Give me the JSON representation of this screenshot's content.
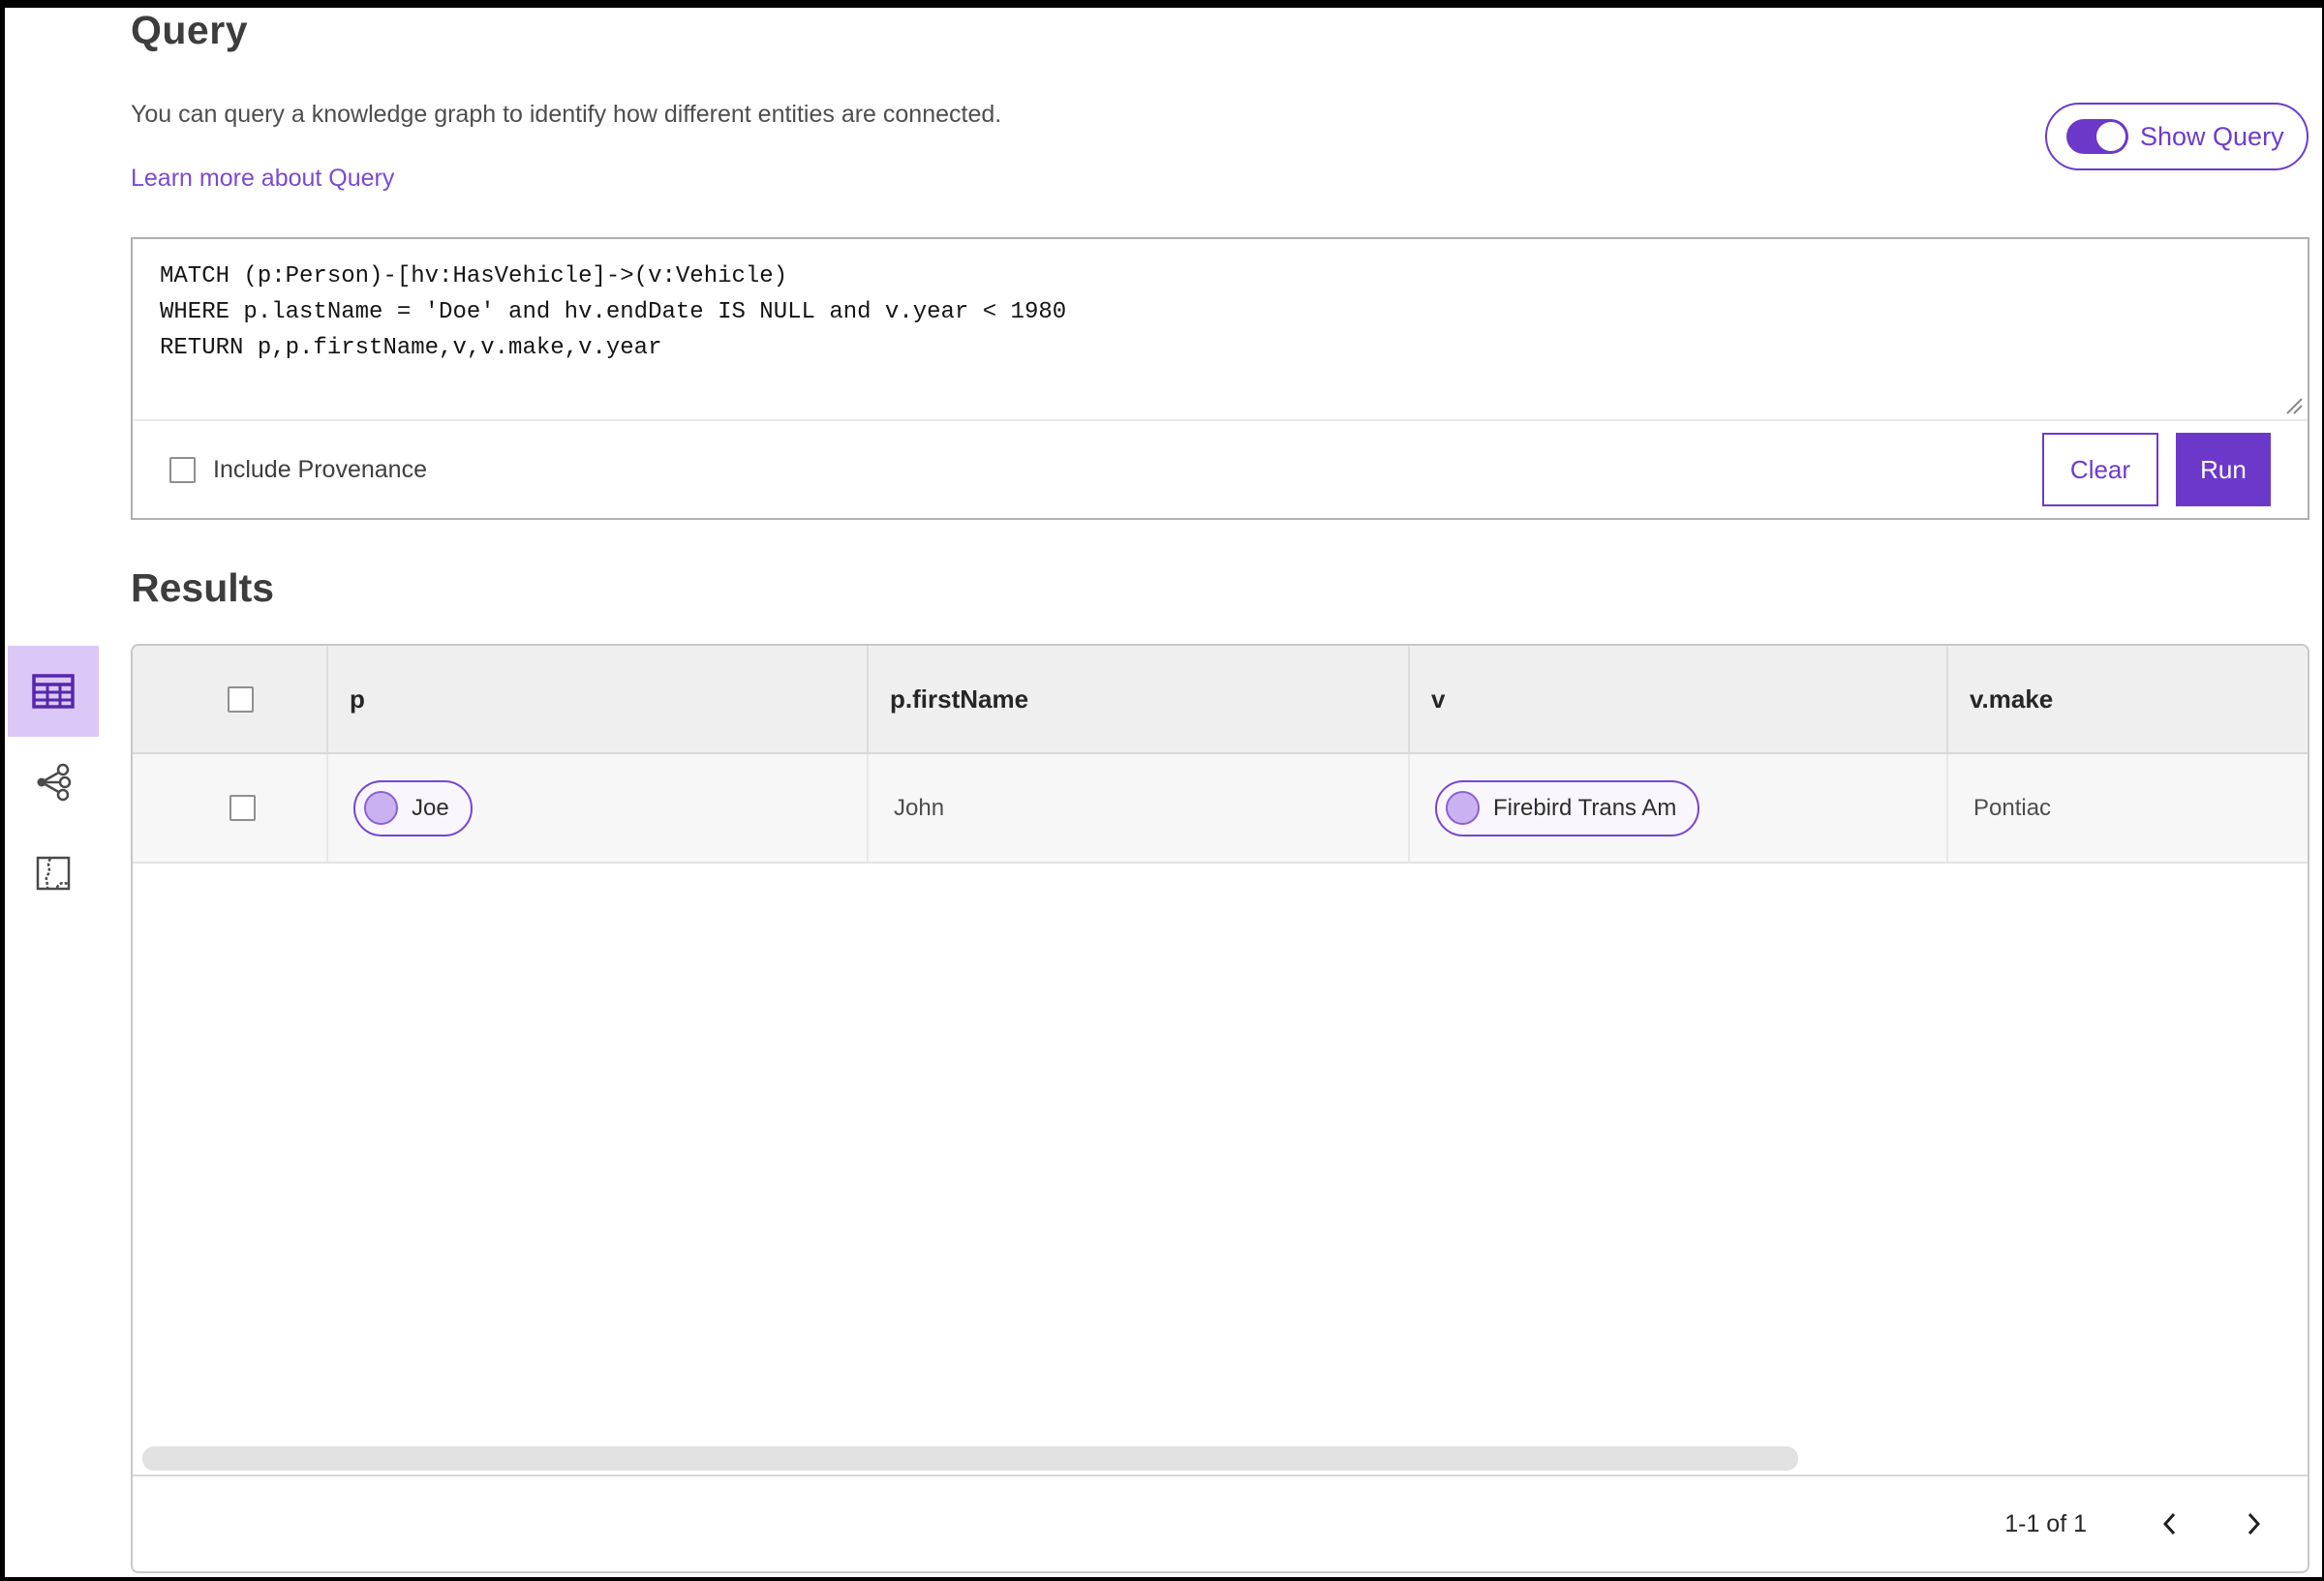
{
  "page": {
    "title": "Query",
    "description": "You can query a knowledge graph to identify how different entities are connected.",
    "learn_more_link": "Learn more about Query",
    "show_query_label": "Show Query",
    "show_query_on": true
  },
  "query_editor": {
    "code": "MATCH (p:Person)-[hv:HasVehicle]->(v:Vehicle)\nWHERE p.lastName = 'Doe' and hv.endDate IS NULL and v.year < 1980\nRETURN p,p.firstName,v,v.make,v.year",
    "include_provenance_label": "Include Provenance",
    "include_provenance_checked": false,
    "clear_label": "Clear",
    "run_label": "Run"
  },
  "results": {
    "title": "Results",
    "views": [
      {
        "icon": "table-view-icon",
        "selected": true
      },
      {
        "icon": "link-chart-view-icon",
        "selected": false
      },
      {
        "icon": "map-view-icon",
        "selected": false
      }
    ],
    "columns": [
      "p",
      "p.firstName",
      "v",
      "v.make"
    ],
    "rows": [
      {
        "p": "Joe",
        "p_firstName": "John",
        "v": "Firebird Trans Am",
        "v_make": "Pontiac",
        "selected": false
      }
    ],
    "pagination": {
      "range_label": "1-1 of 1",
      "prev_icon": "chevron-left-icon",
      "next_icon": "chevron-right-icon"
    }
  },
  "colors": {
    "brand_purple": "#6b38c9",
    "outline_purple": "#6d3bce",
    "link_purple": "#7a4ad1",
    "pill_border": "#7745d2",
    "pill_dot_fill": "#c9b2ef",
    "selected_view_bg": "#dcc8f7",
    "header_bg": "#efefef",
    "row_bg": "#f7f7f7",
    "scroll_thumb": "#e1e1e1"
  }
}
